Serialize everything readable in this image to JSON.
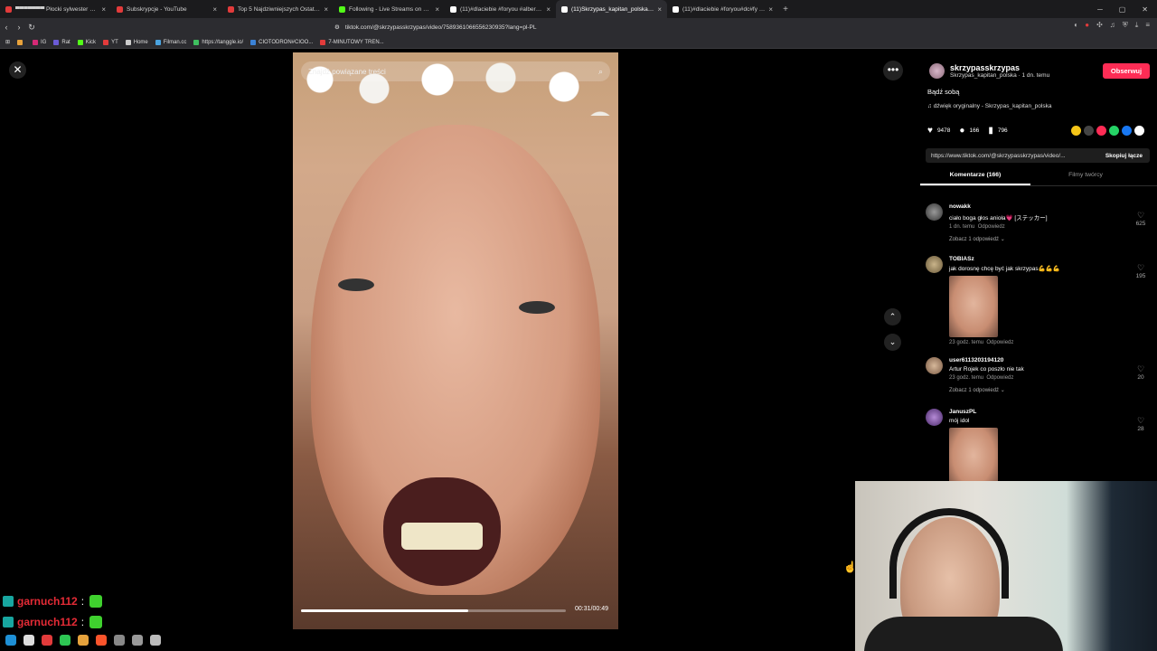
{
  "browser": {
    "tabs": [
      {
        "label": "▀▀▀▀▀▀▀ Płocki sylwester 20…",
        "color": "#e23b3b"
      },
      {
        "label": "Subskrypcje - YouTube",
        "color": "#e23b3b"
      },
      {
        "label": "Top 5 Najdziwniejszych Ostatnich Po…",
        "color": "#e23b3b"
      },
      {
        "label": "Following - Live Streams on Kick",
        "color": "#53fc18"
      },
      {
        "label": "(11)#dlaciebie #foryou #alberto #dn…",
        "color": "#ffffff"
      },
      {
        "label": "(11)Skrzypas_kapitan_polska…",
        "color": "#ffffff",
        "active": true
      },
      {
        "label": "(11)#dlaciebie #foryou#dc#fy #pov…",
        "color": "#ffffff"
      }
    ],
    "new_tab_glyph": "+",
    "url": "tiktok.com/@skrzypasskrzypas/video/7589361066556230935?lang=pl-PL",
    "bookmarks": [
      {
        "label": "",
        "color": "#e8a23b"
      },
      {
        "label": "IG",
        "color": "#d62976"
      },
      {
        "label": "Rat",
        "color": "#6b5bd6"
      },
      {
        "label": "Kick",
        "color": "#53fc18"
      },
      {
        "label": "YT",
        "color": "#e23b3b"
      },
      {
        "label": "Home",
        "color": "#cccccc"
      },
      {
        "label": "Filman.cc",
        "color": "#4aa3df"
      },
      {
        "label": "https://tanggle.io/",
        "color": "#3fbf5f"
      },
      {
        "label": "CIOTODRON#CIOO...",
        "color": "#3b82d6"
      },
      {
        "label": "7-MINUTOWY TREN...",
        "color": "#e23b3b"
      }
    ]
  },
  "tiktok": {
    "search_placeholder": "Znajdź powiązane treści",
    "time": "00:31/00:49",
    "progress": 0.63,
    "author": {
      "username": "skrzypasskrzypas",
      "subtitle": "Skrzypas_kapitan_polska · 1 dn. temu",
      "follow_label": "Obserwuj"
    },
    "description": "Bądź sobą",
    "sound": "dźwięk oryginalny - Skrzypas_kapitan_polska",
    "stats": {
      "likes": "9478",
      "comments": "166",
      "saves": "796"
    },
    "share_colors": [
      "#f5c518",
      "#444444",
      "#fe2c55",
      "#25d366",
      "#1877f2",
      "#ffffff"
    ],
    "link": "https://www.tiktok.com/@skrzypasskrzypas/video/...",
    "copy_label": "Skopiuj łącze",
    "tab_comments": "Komentarze (166)",
    "tab_creator": "Filmy twórcy",
    "comments": [
      {
        "user": "nowakk",
        "text": "ciało boga głos anioła💗 [ステッカー]",
        "time": "1 dn. temu",
        "reply": "Odpowiedz",
        "likes": "625",
        "more": "Zobacz 1 odpowiedź ⌄"
      },
      {
        "user": "TOBIASz",
        "text": "jak dorosnę chcę być jak skrzypas💪💪💪",
        "time": "23 godz. temu",
        "reply": "Odpowiedz",
        "likes": "195"
      },
      {
        "user": "user6113203194120",
        "text": "Artur Rojek co poszło nie tak",
        "time": "23 godz. temu",
        "reply": "Odpowiedz",
        "likes": "20",
        "more": "Zobacz 1 odpowiedź ⌄"
      },
      {
        "user": "JanuszPL",
        "text": "mój idol",
        "likes": "28"
      }
    ]
  },
  "stream_chat": [
    {
      "user": "garnuch112"
    },
    {
      "user": "garnuch112"
    }
  ]
}
